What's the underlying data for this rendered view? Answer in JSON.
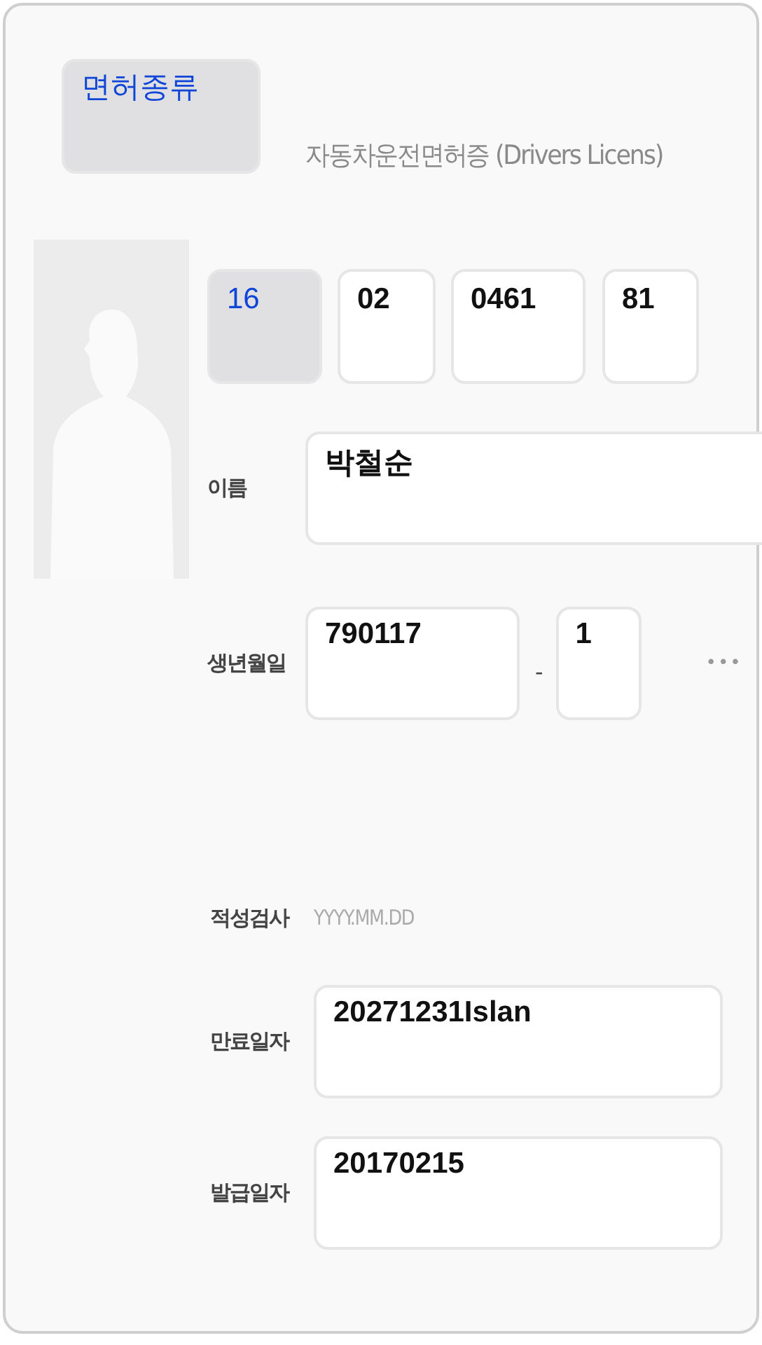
{
  "license_type": {
    "value": "면허종류",
    "highlighted": true
  },
  "title": "자동차운전면허증 (Drivers Licens)",
  "license_number": [
    {
      "value": "16",
      "highlighted": true
    },
    {
      "value": "02",
      "highlighted": false
    },
    {
      "value": "0461",
      "highlighted": false
    },
    {
      "value": "81",
      "highlighted": false
    }
  ],
  "name": {
    "label": "이름",
    "value": "박철순"
  },
  "birth": {
    "label": "생년월일",
    "date": "790117",
    "separator": "-",
    "gender": "1",
    "masked": "•••"
  },
  "aptitude_test": {
    "label": "적성검사",
    "placeholder": "YYYY.MM.DD"
  },
  "expiry": {
    "label": "만료일자",
    "value": "20271231Islan"
  },
  "issue": {
    "label": "발급일자",
    "value": "20170215"
  }
}
